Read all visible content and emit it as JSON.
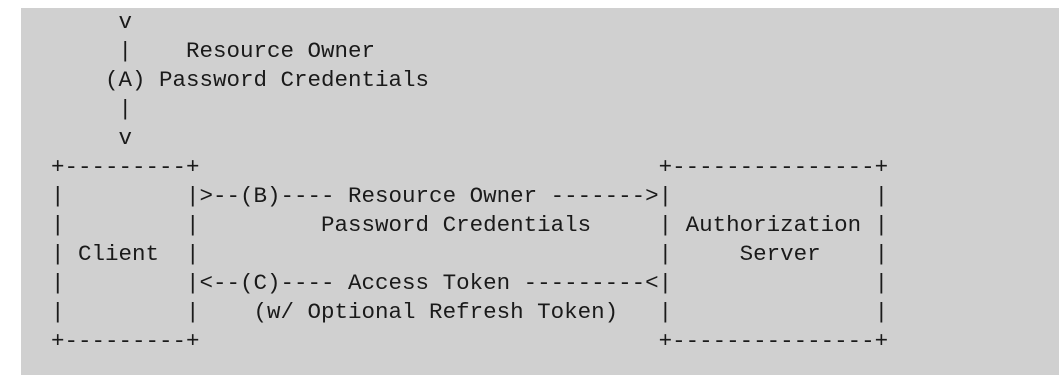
{
  "diagram": {
    "lines": [
      "     v",
      "     |    Resource Owner",
      "    (A) Password Credentials",
      "     |",
      "     v",
      "+---------+                                  +---------------+",
      "|         |>--(B)---- Resource Owner ------->|               |",
      "|         |         Password Credentials     | Authorization |",
      "| Client  |                                  |     Server    |",
      "|         |<--(C)---- Access Token ---------<|               |",
      "|         |    (w/ Optional Refresh Token)   |               |",
      "+---------+                                  +---------------+"
    ]
  }
}
